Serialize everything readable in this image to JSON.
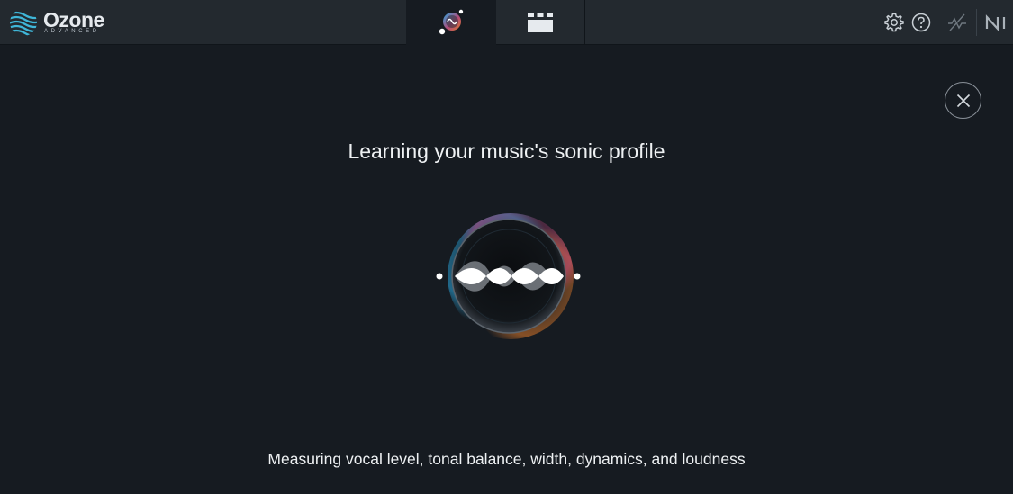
{
  "header": {
    "app_name": "Ozone",
    "app_edition": "ADVANCED",
    "tabs": [
      {
        "name": "assistant",
        "icon": "assistant-icon",
        "active": true
      },
      {
        "name": "modules",
        "icon": "modules-icon",
        "active": false
      }
    ],
    "icons": [
      "settings-gear-icon",
      "help-icon",
      "bypass-icon",
      "ni-logo-icon"
    ]
  },
  "main": {
    "title": "Learning your music's sonic profile",
    "status": "Measuring vocal level, tonal balance, width, dynamics, and loudness",
    "close_icon": "close-icon"
  },
  "colors": {
    "background": "#161b21",
    "topbar": "#23292f",
    "text": "#eef1f3",
    "glow_blue": "#2aa8e0",
    "glow_orange": "#e07a2a",
    "glow_pink": "#d24a8a"
  }
}
